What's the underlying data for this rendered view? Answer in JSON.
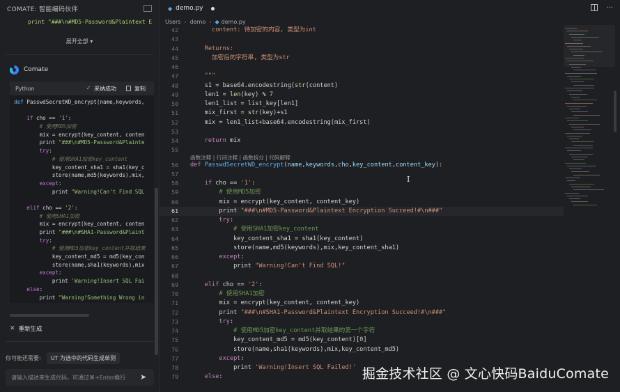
{
  "left_panel": {
    "title": "COMATE: 智能编码伙伴",
    "prev_code_line": "print \"###\\n#MD5-Password&Plaintext E",
    "expand_all": "展开全部 ▾",
    "assistant_name": "Comate",
    "code_card": {
      "language": "Python",
      "accept_label": "采纳成功",
      "copy_label": "复制",
      "lines": [
        {
          "indent": 0,
          "parts": [
            [
              "fn",
              "def "
            ],
            [
              "fnb",
              "PasswdSecretWD_encrypt"
            ],
            [
              "",
              "(name,keywords,"
            ]
          ]
        },
        {
          "indent": 0,
          "parts": [
            [
              "",
              ""
            ]
          ]
        },
        {
          "indent": 2,
          "parts": [
            [
              "kw",
              "if "
            ],
            [
              "",
              "cho == "
            ],
            [
              "st",
              "'1'"
            ],
            [
              "",
              ":"
            ]
          ]
        },
        {
          "indent": 4,
          "parts": [
            [
              "cm",
              "# 使用MD5加密"
            ]
          ]
        },
        {
          "indent": 4,
          "parts": [
            [
              "",
              "mix = encrypt(key_content, conten"
            ]
          ]
        },
        {
          "indent": 4,
          "parts": [
            [
              "",
              "print "
            ],
            [
              "st",
              "\"###\\n#MD5-Password&Plainte"
            ]
          ]
        },
        {
          "indent": 4,
          "parts": [
            [
              "kw",
              "try"
            ],
            [
              "",
              ":"
            ]
          ]
        },
        {
          "indent": 6,
          "parts": [
            [
              "cm",
              "# 使用SHA1加密key_content"
            ]
          ]
        },
        {
          "indent": 6,
          "parts": [
            [
              "",
              "key_content_sha1 = sha1(key_c"
            ]
          ]
        },
        {
          "indent": 6,
          "parts": [
            [
              "",
              "store(name,md5(keywords),mix,"
            ]
          ]
        },
        {
          "indent": 4,
          "parts": [
            [
              "kw",
              "except"
            ],
            [
              "",
              ":"
            ]
          ]
        },
        {
          "indent": 6,
          "parts": [
            [
              "",
              "print "
            ],
            [
              "st",
              "\"Warning!Can't Find SQL"
            ]
          ]
        },
        {
          "indent": 0,
          "parts": [
            [
              "",
              ""
            ]
          ]
        },
        {
          "indent": 2,
          "parts": [
            [
              "kw",
              "elif "
            ],
            [
              "",
              "cho == "
            ],
            [
              "st",
              "'2'"
            ],
            [
              "",
              ":"
            ]
          ]
        },
        {
          "indent": 4,
          "parts": [
            [
              "cm",
              "# 使用SHA1加密"
            ]
          ]
        },
        {
          "indent": 4,
          "parts": [
            [
              "",
              "mix = encrypt(key_content, conten"
            ]
          ]
        },
        {
          "indent": 4,
          "parts": [
            [
              "",
              "print "
            ],
            [
              "st",
              "\"###\\n#SHA1-Password&Plaint"
            ]
          ]
        },
        {
          "indent": 4,
          "parts": [
            [
              "kw",
              "try"
            ],
            [
              "",
              ":"
            ]
          ]
        },
        {
          "indent": 6,
          "parts": [
            [
              "cm",
              "# 使用MD5加密key_content并取结果"
            ]
          ]
        },
        {
          "indent": 6,
          "parts": [
            [
              "",
              "key_content_md5 = md5(key_con"
            ]
          ]
        },
        {
          "indent": 6,
          "parts": [
            [
              "",
              "store(name,sha1(keywords),mix"
            ]
          ]
        },
        {
          "indent": 4,
          "parts": [
            [
              "kw",
              "except"
            ],
            [
              "",
              ":"
            ]
          ]
        },
        {
          "indent": 6,
          "parts": [
            [
              "",
              "print "
            ],
            [
              "st",
              "'Warning!Insert SQL Fai"
            ]
          ]
        },
        {
          "indent": 2,
          "parts": [
            [
              "kw",
              "else"
            ],
            [
              "",
              ":"
            ]
          ]
        },
        {
          "indent": 4,
          "parts": [
            [
              "",
              "print "
            ],
            [
              "st",
              "\"Warning!Something Wrong in"
            ]
          ]
        }
      ]
    },
    "regenerate_label": "重新生成",
    "suggest_label": "你可能还需要:",
    "suggest_chip": "UT 为选中的代码生成单测",
    "input_placeholder": "请输入描述来生成代码，可通过⌘+Enter换行"
  },
  "editor": {
    "tab_name": "demo.py",
    "breadcrumb": [
      "Users",
      "demo",
      "demo.py"
    ],
    "codelens": "函数注释 | 行间注释 | 函数拆分 | 代码解释",
    "active_line": 61,
    "lines": [
      {
        "n": 42,
        "i": 3,
        "parts": [
          [
            "doc",
            "content: 待加密的内容, 类型为int"
          ]
        ]
      },
      {
        "n": 43,
        "i": 0,
        "parts": []
      },
      {
        "n": 44,
        "i": 2,
        "parts": [
          [
            "doc",
            "Returns:"
          ]
        ]
      },
      {
        "n": 45,
        "i": 3,
        "parts": [
          [
            "doc",
            "加密后的字符串, 类型为str"
          ]
        ]
      },
      {
        "n": 46,
        "i": 0,
        "parts": []
      },
      {
        "n": 47,
        "i": 2,
        "parts": [
          [
            "doc",
            "\"\"\""
          ]
        ]
      },
      {
        "n": 48,
        "i": 2,
        "parts": [
          [
            "",
            "s1 = base64.encodestring("
          ],
          [
            "fn",
            "str"
          ],
          [
            "",
            "(content)"
          ]
        ]
      },
      {
        "n": 49,
        "i": 2,
        "parts": [
          [
            "",
            "len1 = "
          ],
          [
            "fn",
            "len"
          ],
          [
            "",
            "(key) % "
          ],
          [
            "nm",
            "7"
          ]
        ]
      },
      {
        "n": 50,
        "i": 2,
        "parts": [
          [
            "",
            "len1_list = list_key[len1]"
          ]
        ]
      },
      {
        "n": 51,
        "i": 2,
        "parts": [
          [
            "",
            "mix_first = "
          ],
          [
            "fn",
            "str"
          ],
          [
            "",
            "(key)+s1"
          ]
        ]
      },
      {
        "n": 52,
        "i": 2,
        "parts": [
          [
            "",
            "mix = len1_list+base64.encodestring(mix_first)"
          ]
        ]
      },
      {
        "n": 53,
        "i": 0,
        "parts": []
      },
      {
        "n": 54,
        "i": 2,
        "parts": [
          [
            "kw",
            "return "
          ],
          [
            "",
            "mix"
          ]
        ]
      },
      {
        "n": 55,
        "i": 0,
        "parts": []
      },
      {
        "n": 56,
        "i": 0,
        "parts": [
          [
            "kw",
            "def "
          ],
          [
            "fnb",
            "PasswdSecretWD_encrypt"
          ],
          [
            "",
            "("
          ],
          [
            "pm",
            "name"
          ],
          [
            "",
            ","
          ],
          [
            "pm",
            "keywords"
          ],
          [
            "",
            ","
          ],
          [
            "pm",
            "cho"
          ],
          [
            "",
            ","
          ],
          [
            "pm",
            "key_content"
          ],
          [
            "",
            ","
          ],
          [
            "pm",
            "content_key"
          ],
          [
            "",
            "):"
          ]
        ]
      },
      {
        "n": 57,
        "i": 0,
        "parts": []
      },
      {
        "n": 58,
        "i": 2,
        "parts": [
          [
            "kw",
            "if "
          ],
          [
            "",
            "cho == "
          ],
          [
            "st",
            "'1'"
          ],
          [
            "",
            ":"
          ]
        ]
      },
      {
        "n": 59,
        "i": 4,
        "parts": [
          [
            "cm",
            "# 使用MD5加密"
          ]
        ]
      },
      {
        "n": 60,
        "i": 4,
        "parts": [
          [
            "",
            "mix = encrypt(key_content, content_key)"
          ]
        ]
      },
      {
        "n": 61,
        "i": 4,
        "parts": [
          [
            "",
            "print "
          ],
          [
            "st",
            "\"###\\n#MD5-Password&Plaintext Encryption Succeed!#\\n###\""
          ]
        ]
      },
      {
        "n": 62,
        "i": 4,
        "parts": [
          [
            "kw",
            "try"
          ],
          [
            "",
            ":"
          ]
        ]
      },
      {
        "n": 63,
        "i": 6,
        "parts": [
          [
            "cm",
            "# 使用SHA1加密key_content"
          ]
        ]
      },
      {
        "n": 64,
        "i": 6,
        "parts": [
          [
            "",
            "key_content_sha1 = sha1(key_content)"
          ]
        ]
      },
      {
        "n": 65,
        "i": 6,
        "parts": [
          [
            "",
            "store(name,md5(keywords),mix,key_content_sha1)"
          ]
        ]
      },
      {
        "n": 66,
        "i": 4,
        "parts": [
          [
            "kw",
            "except"
          ],
          [
            "",
            ":"
          ]
        ]
      },
      {
        "n": 67,
        "i": 6,
        "parts": [
          [
            "",
            "print "
          ],
          [
            "st",
            "\"Warning!Can't Find SQL!\""
          ]
        ]
      },
      {
        "n": 68,
        "i": 0,
        "parts": []
      },
      {
        "n": 69,
        "i": 2,
        "parts": [
          [
            "kw",
            "elif "
          ],
          [
            "",
            "cho == "
          ],
          [
            "st",
            "'2'"
          ],
          [
            "",
            ":"
          ]
        ]
      },
      {
        "n": 70,
        "i": 4,
        "parts": [
          [
            "cm",
            "# 使用SHA1加密"
          ]
        ]
      },
      {
        "n": 71,
        "i": 4,
        "parts": [
          [
            "",
            "mix = encrypt(key_content, content_key)"
          ]
        ]
      },
      {
        "n": 72,
        "i": 4,
        "parts": [
          [
            "",
            "print "
          ],
          [
            "st",
            "\"###\\n#SHA1-Password&Plaintext Encryption Succeed!#\\n###\""
          ]
        ]
      },
      {
        "n": 73,
        "i": 4,
        "parts": [
          [
            "kw",
            "try"
          ],
          [
            "",
            ":"
          ]
        ]
      },
      {
        "n": 74,
        "i": 6,
        "parts": [
          [
            "cm",
            "# 使用MD5加密key_content并取结果的第一个字符"
          ]
        ]
      },
      {
        "n": 75,
        "i": 6,
        "parts": [
          [
            "",
            "key_content_md5 = md5(key_content)["
          ],
          [
            "nm",
            "0"
          ],
          [
            "",
            "]"
          ]
        ]
      },
      {
        "n": 76,
        "i": 6,
        "parts": [
          [
            "",
            "store(name,sha1(keywords),mix,key_content_md5)"
          ]
        ]
      },
      {
        "n": 77,
        "i": 4,
        "parts": [
          [
            "kw",
            "except"
          ],
          [
            "",
            ":"
          ]
        ]
      },
      {
        "n": 78,
        "i": 6,
        "parts": [
          [
            "",
            "print "
          ],
          [
            "st",
            "'Warning!Insert SQL Failed!'"
          ]
        ]
      },
      {
        "n": 79,
        "i": 2,
        "parts": [
          [
            "kw",
            "else"
          ],
          [
            "",
            ":"
          ]
        ]
      }
    ]
  },
  "watermark": "掘金技术社区 @ 文心快码BaiduComate",
  "colors": {
    "keyword": "#c586c0",
    "string": "#ce9178",
    "comment": "#6a9955",
    "function": "#dcdcaa",
    "accept_check": "#5fbf6a"
  }
}
